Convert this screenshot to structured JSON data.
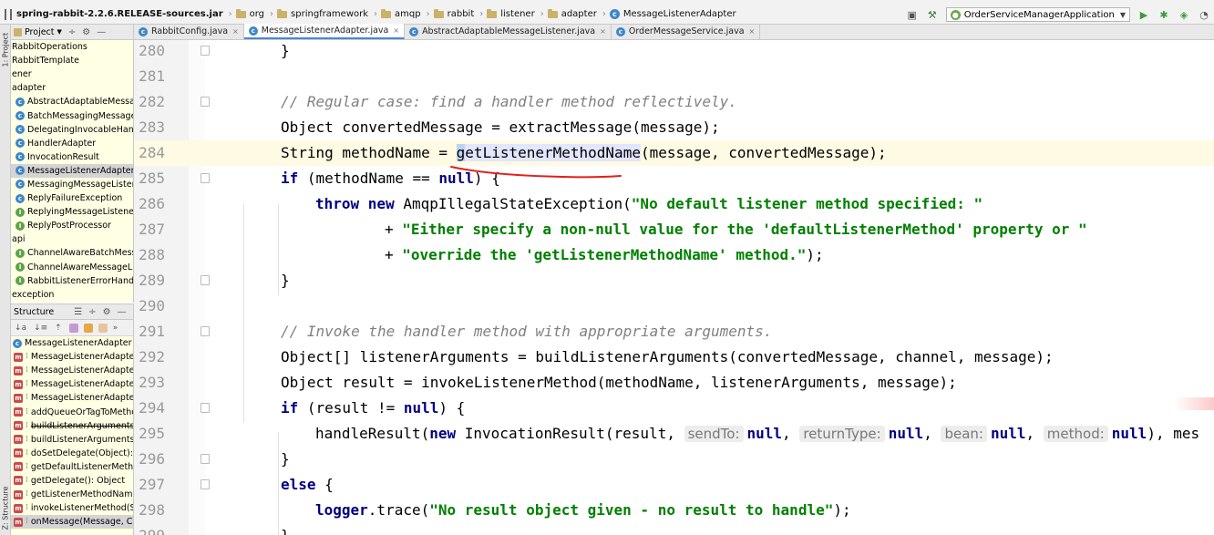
{
  "nav": {
    "crumbs": [
      "spring-rabbit-2.2.6.RELEASE-sources.jar",
      "org",
      "springframework",
      "amqp",
      "rabbit",
      "listener",
      "adapter",
      "MessageListenerAdapter"
    ],
    "run_config": "OrderServiceManagerApplication"
  },
  "stripe": {
    "project": "1: Project",
    "structure": "Z: Structure"
  },
  "project_panel": {
    "title": "Project",
    "rows": [
      {
        "text": "RabbitOperations",
        "icon": "none",
        "selected": false
      },
      {
        "text": "RabbitTemplate",
        "icon": "none",
        "selected": false
      },
      {
        "text": "ener",
        "icon": "none",
        "selected": false
      },
      {
        "text": "adapter",
        "icon": "none",
        "selected": false
      },
      {
        "text": "AbstractAdaptableMessage",
        "icon": "class",
        "selected": false
      },
      {
        "text": "BatchMessagingMessageLis",
        "icon": "class",
        "selected": false
      },
      {
        "text": "DelegatingInvocableHandle",
        "icon": "class",
        "selected": false
      },
      {
        "text": "HandlerAdapter",
        "icon": "class",
        "selected": false
      },
      {
        "text": "InvocationResult",
        "icon": "class",
        "selected": false
      },
      {
        "text": "MessageListenerAdapter",
        "icon": "class",
        "selected": true
      },
      {
        "text": "MessagingMessageListener",
        "icon": "class",
        "selected": false
      },
      {
        "text": "ReplyFailureException",
        "icon": "class",
        "selected": false
      },
      {
        "text": "ReplyingMessageListener",
        "icon": "interface",
        "selected": false
      },
      {
        "text": "ReplyPostProcessor",
        "icon": "interface",
        "selected": false
      },
      {
        "text": "api",
        "icon": "none",
        "selected": false
      },
      {
        "text": "ChannelAwareBatchMessag",
        "icon": "interface",
        "selected": false
      },
      {
        "text": "ChannelAwareMessageListe",
        "icon": "interface",
        "selected": false
      },
      {
        "text": "RabbitListenerErrorHandler",
        "icon": "interface",
        "selected": false
      },
      {
        "text": "exception",
        "icon": "none",
        "selected": false
      }
    ]
  },
  "structure_panel": {
    "title": "Structure",
    "root": "MessageListenerAdapter",
    "rows": [
      {
        "text": "MessageListenerAdapter(",
        "selected": false
      },
      {
        "text": "MessageListenerAdapter(",
        "selected": false
      },
      {
        "text": "MessageListenerAdapter(",
        "selected": false
      },
      {
        "text": "MessageListenerAdapter(",
        "selected": false
      },
      {
        "text": "addQueueOrTagToMetho",
        "selected": false
      },
      {
        "text": "buildListenerArguments(O",
        "selected": false
      },
      {
        "text": "buildListenerArguments(O",
        "selected": false
      },
      {
        "text": "doSetDelegate(Object): vo",
        "selected": false
      },
      {
        "text": "getDefaultListenerMethod",
        "selected": false
      },
      {
        "text": "getDelegate(): Object",
        "selected": false
      },
      {
        "text": "getListenerMethodName(",
        "selected": false
      },
      {
        "text": "invokeListenerMethod(Str",
        "selected": false
      },
      {
        "text": "onMessage(Message, Ch",
        "selected": true
      }
    ]
  },
  "tabs": [
    {
      "label": "RabbitConfig.java",
      "active": false
    },
    {
      "label": "MessageListenerAdapter.java",
      "active": true
    },
    {
      "label": "AbstractAdaptableMessageListener.java",
      "active": false
    },
    {
      "label": "OrderMessageService.java",
      "active": false
    }
  ],
  "editor": {
    "lines": [
      {
        "n": "280",
        "fold": true,
        "indent": 1,
        "parts": [
          {
            "t": "}",
            "c": ""
          }
        ]
      },
      {
        "n": "281",
        "fold": false,
        "indent": 0,
        "parts": []
      },
      {
        "n": "282",
        "fold": true,
        "indent": 1,
        "parts": [
          {
            "t": "// Regular case: find a handler method reflectively.",
            "c": "cm"
          }
        ]
      },
      {
        "n": "283",
        "fold": false,
        "indent": 1,
        "parts": [
          {
            "t": "Object convertedMessage = extractMessage(message);",
            "c": ""
          }
        ]
      },
      {
        "n": "284",
        "fold": false,
        "indent": 1,
        "current": true,
        "parts": [
          {
            "t": "String methodName = ",
            "c": ""
          },
          {
            "t": "g",
            "c": "cursor-box"
          },
          {
            "t": "etListenerMethodName",
            "c": "hl"
          },
          {
            "t": "(message, convertedMessage);",
            "c": ""
          }
        ]
      },
      {
        "n": "285",
        "fold": true,
        "indent": 1,
        "parts": [
          {
            "t": "if",
            "c": "kw"
          },
          {
            "t": " (methodName == ",
            "c": ""
          },
          {
            "t": "null",
            "c": "kw"
          },
          {
            "t": ") {",
            "c": ""
          }
        ]
      },
      {
        "n": "286",
        "fold": false,
        "indent": 2,
        "parts": [
          {
            "t": "throw new",
            "c": "kw"
          },
          {
            "t": " AmqpIllegalStateException(",
            "c": ""
          },
          {
            "t": "\"No default listener method specified: \"",
            "c": "str"
          }
        ]
      },
      {
        "n": "287",
        "fold": false,
        "indent": 4,
        "parts": [
          {
            "t": "+ ",
            "c": ""
          },
          {
            "t": "\"Either specify a non-null value for the 'defaultListenerMethod' property or \"",
            "c": "str"
          }
        ]
      },
      {
        "n": "288",
        "fold": false,
        "indent": 4,
        "parts": [
          {
            "t": "+ ",
            "c": ""
          },
          {
            "t": "\"override the 'getListenerMethodName' method.\"",
            "c": "str"
          },
          {
            "t": ");",
            "c": ""
          }
        ]
      },
      {
        "n": "289",
        "fold": true,
        "indent": 1,
        "parts": [
          {
            "t": "}",
            "c": ""
          }
        ]
      },
      {
        "n": "290",
        "fold": false,
        "indent": 0,
        "parts": []
      },
      {
        "n": "291",
        "fold": true,
        "indent": 1,
        "parts": [
          {
            "t": "// Invoke the handler method with appropriate arguments.",
            "c": "cm"
          }
        ]
      },
      {
        "n": "292",
        "fold": false,
        "indent": 1,
        "parts": [
          {
            "t": "Object[] listenerArguments = buildListenerArguments(convertedMessage, channel, message);",
            "c": ""
          }
        ]
      },
      {
        "n": "293",
        "fold": false,
        "indent": 1,
        "parts": [
          {
            "t": "Object result = invokeListenerMethod(methodName, listenerArguments, message);",
            "c": ""
          }
        ]
      },
      {
        "n": "294",
        "fold": true,
        "indent": 1,
        "parts": [
          {
            "t": "if",
            "c": "kw"
          },
          {
            "t": " (result != ",
            "c": ""
          },
          {
            "t": "null",
            "c": "kw"
          },
          {
            "t": ") {",
            "c": ""
          }
        ]
      },
      {
        "n": "295",
        "fold": false,
        "indent": 2,
        "parts": [
          {
            "t": "handleResult(",
            "c": ""
          },
          {
            "t": "new",
            "c": "kw"
          },
          {
            "t": " InvocationResult(result, ",
            "c": ""
          },
          {
            "t": "sendTo:",
            "c": "hint"
          },
          {
            "t": "null",
            "c": "kw"
          },
          {
            "t": ", ",
            "c": ""
          },
          {
            "t": "returnType:",
            "c": "hint"
          },
          {
            "t": "null",
            "c": "kw"
          },
          {
            "t": ", ",
            "c": ""
          },
          {
            "t": "bean:",
            "c": "hint"
          },
          {
            "t": "null",
            "c": "kw"
          },
          {
            "t": ", ",
            "c": ""
          },
          {
            "t": "method:",
            "c": "hint"
          },
          {
            "t": "null",
            "c": "kw"
          },
          {
            "t": "), mes",
            "c": ""
          }
        ]
      },
      {
        "n": "296",
        "fold": true,
        "indent": 1,
        "parts": [
          {
            "t": "}",
            "c": ""
          }
        ]
      },
      {
        "n": "297",
        "fold": true,
        "indent": 1,
        "parts": [
          {
            "t": "else",
            "c": "kw"
          },
          {
            "t": " {",
            "c": ""
          }
        ]
      },
      {
        "n": "298",
        "fold": false,
        "indent": 2,
        "parts": [
          {
            "t": "logger",
            "c": "kw"
          },
          {
            "t": ".trace(",
            "c": ""
          },
          {
            "t": "\"No result object given - no result to handle\"",
            "c": "str"
          },
          {
            "t": ");",
            "c": ""
          }
        ]
      },
      {
        "n": "299",
        "fold": false,
        "indent": 1,
        "parts": [
          {
            "t": "}",
            "c": ""
          }
        ]
      }
    ]
  },
  "colors": {
    "keyword": "#000080",
    "comment": "#808080",
    "string": "#008000",
    "current_line": "#fffae3",
    "selection": "#e2e6ff",
    "panel_bg": "#ffffe4",
    "underline_annotation": "#e0201c"
  }
}
